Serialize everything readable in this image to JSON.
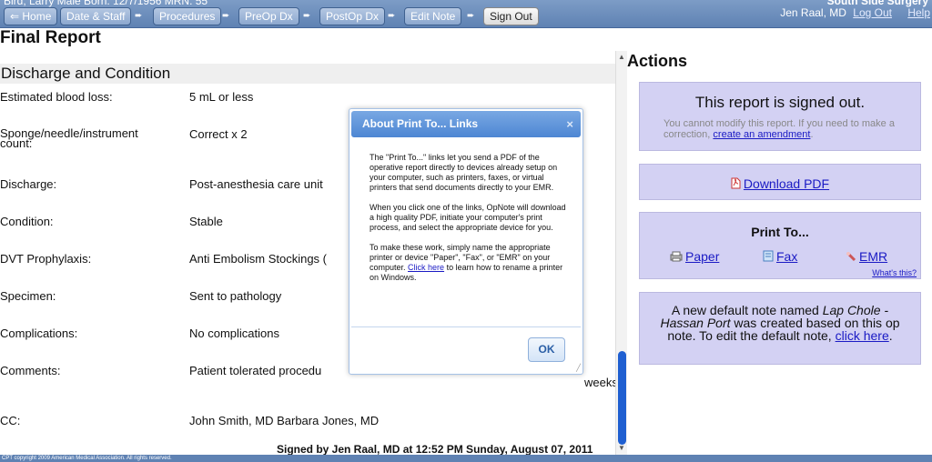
{
  "header": {
    "patient": "Bird, Larry     Male     Born: 12/7/1956     MRN: 55",
    "facility": "South Side Surgery",
    "user": "Jen Raal, MD",
    "logout": "Log Out",
    "help": "Help"
  },
  "nav": {
    "home": "⇐ Home",
    "date_staff": "Date & Staff",
    "procedures": "Procedures",
    "preop": "PreOp Dx",
    "postop": "PostOp Dx",
    "edit_note": "Edit Note",
    "sign_out": "Sign Out",
    "arrow": "➨"
  },
  "report": {
    "title": "Final Report",
    "section": "Discharge and Condition",
    "rows": [
      {
        "label": "Estimated blood loss:",
        "value": "5 mL or less"
      },
      {
        "label": "Sponge/needle/instrument count:",
        "value": "Correct x 2"
      },
      {
        "label": "Discharge:",
        "value": "Post-anesthesia care unit"
      },
      {
        "label": "Condition:",
        "value": "Stable"
      },
      {
        "label": "DVT Prophylaxis:",
        "value": "Anti Embolism Stockings ("
      },
      {
        "label": "Specimen:",
        "value": "Sent to pathology"
      },
      {
        "label": "Complications:",
        "value": "No complications"
      },
      {
        "label": "Comments:",
        "value": "Patient tolerated procedu"
      },
      {
        "label": "CC:",
        "value": "John Smith, MD Barbara Jones, MD"
      }
    ],
    "comments_cont": "weeks.",
    "signed": "Signed by Jen Raal, MD at 12:52 PM Sunday, August 07, 2011"
  },
  "scroll": {
    "up": "▲",
    "down": "▼"
  },
  "footer": {
    "copyright": "CPT copyright 2009 American Medical Association. All rights reserved."
  },
  "actions": {
    "title": "Actions",
    "signed_heading": "This report is signed out.",
    "signed_text": "You cannot modify this report. If you need to make a correction,",
    "amend_link": "create an amendment",
    "period": ".",
    "download": "Download PDF",
    "print_title": "Print To...",
    "paper": "Paper",
    "fax": "Fax",
    "emr": "EMR",
    "whats_this": "What's this?",
    "note_text1": "A new default note named",
    "note_name": "Lap Chole - Hassan Port",
    "note_text2": "was created based on this op note. To edit the default note,",
    "click_here": "click here",
    "note_end": "."
  },
  "dialog": {
    "title": "About Print To... Links",
    "close": "×",
    "p1": "The \"Print To...\" links let you send a PDF of the operative report directly to devices already setup on your computer, such as printers, faxes, or virtual printers that send documents directly to your EMR.",
    "p2": "When you click one of the links, OpNote will download a high quality PDF, initiate your computer's print process, and select the appropriate device for you.",
    "p3a": "To make these work, simply name the appropriate printer or device \"Paper\", \"Fax\", or \"EMR\" on your computer.",
    "p3link": "Click here",
    "p3b": "to learn how to rename a printer on Windows.",
    "ok": "OK",
    "grip": "╱"
  },
  "icons": {
    "pdf": "pdf-icon",
    "printer": "printer-icon",
    "fax": "fax-icon",
    "emr": "emr-icon"
  }
}
